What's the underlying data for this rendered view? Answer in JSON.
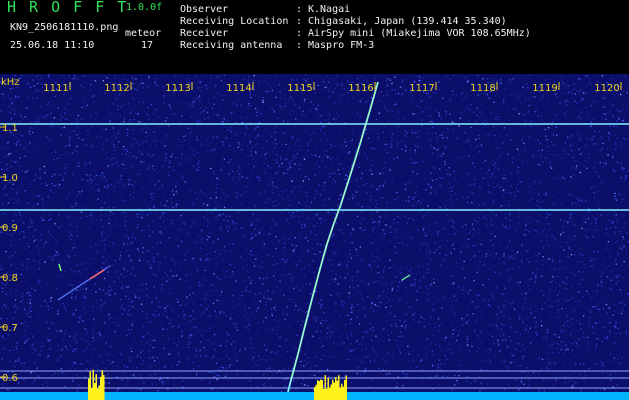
{
  "header": {
    "app_title": "H R O F F T",
    "version": "1.0.0f",
    "filename": "KN9_2506181110.png",
    "meteor_label": "meteor",
    "timestamp": "25.06.18 11:10",
    "meteor_count": "17",
    "info": [
      {
        "label": "Observer",
        "value": "K.Nagai"
      },
      {
        "label": "Receiving Location",
        "value": "Chigasaki, Japan (139.414 35.340)"
      },
      {
        "label": "Receiver",
        "value": "AirSpy mini (Miakejima VOR 108.65MHz)"
      },
      {
        "label": "Receiving antenna",
        "value": "Maspro FM-3"
      }
    ]
  },
  "plot": {
    "unit_label": "kHz",
    "time_ticks": [
      "1111",
      "1112",
      "1113",
      "1114",
      "1115",
      "1116",
      "1117",
      "1118",
      "1119",
      "1120"
    ],
    "freq_ticks": [
      "1.1",
      "1.0",
      "0.9",
      "0.8",
      "0.7",
      "0.6"
    ],
    "colors": {
      "background": "#0b0f6a",
      "noise": "#2a3bd0",
      "signal_line": "#7ff2ff",
      "baseline": "#00c8ff",
      "burst": "#fff21a",
      "tick_text": "#f2d21e"
    }
  }
}
